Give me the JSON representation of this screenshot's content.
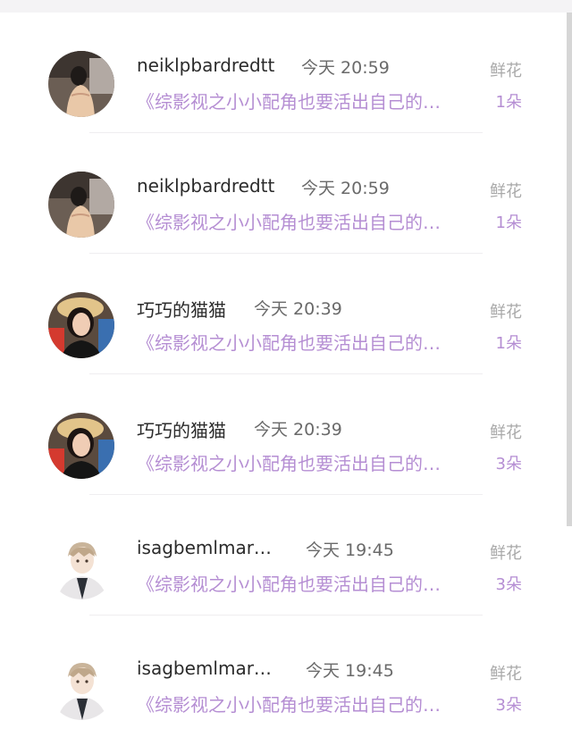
{
  "rows": [
    {
      "username": "neiklpbardredtt",
      "time": "今天 20:59",
      "type": "鲜花",
      "book": "《综影视之小小配角也要活出自己的…",
      "count": "1朵",
      "avatar": "photo-back-icon"
    },
    {
      "username": "neiklpbardredtt",
      "time": "今天 20:59",
      "type": "鲜花",
      "book": "《综影视之小小配角也要活出自己的…",
      "count": "1朵",
      "avatar": "photo-back-icon"
    },
    {
      "username": "巧巧的猫猫",
      "time": "今天 20:39",
      "type": "鲜花",
      "book": "《综影视之小小配角也要活出自己的…",
      "count": "1朵",
      "avatar": "photo-woman-hat-icon"
    },
    {
      "username": "巧巧的猫猫",
      "time": "今天 20:39",
      "type": "鲜花",
      "book": "《综影视之小小配角也要活出自己的…",
      "count": "3朵",
      "avatar": "photo-woman-hat-icon"
    },
    {
      "username": "isagbemlmar…",
      "time": "今天 19:45",
      "type": "鲜花",
      "book": "《综影视之小小配角也要活出自己的…",
      "count": "3朵",
      "avatar": "anime-boy-icon"
    },
    {
      "username": "isagbemlmar…",
      "time": "今天 19:45",
      "type": "鲜花",
      "book": "《综影视之小小配角也要活出自己的…",
      "count": "3朵",
      "avatar": "anime-boy-icon"
    }
  ],
  "colors": {
    "accent": "#b58ed3",
    "username": "#2b2b2b",
    "time": "#6a6a6a",
    "type_label": "#a9a9a9"
  }
}
